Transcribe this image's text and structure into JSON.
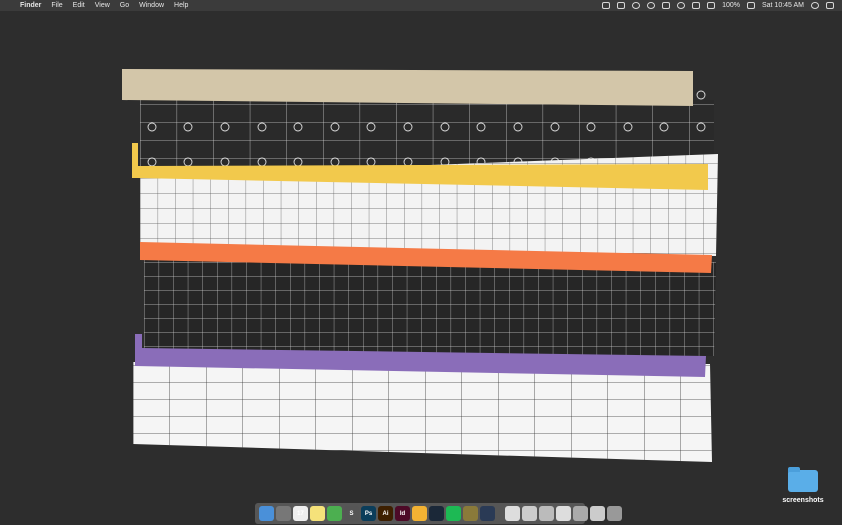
{
  "menubar": {
    "apple_glyph": "",
    "app_name": "Finder",
    "menus": [
      "File",
      "Edit",
      "View",
      "Go",
      "Window",
      "Help"
    ],
    "battery": "100%",
    "clock": "Sat 10:45 AM"
  },
  "desktop": {
    "folder_label": "screenshots"
  },
  "colors": {
    "tan": "#d3c6a9",
    "yellow": "#f2c94c",
    "orange": "#f57a46",
    "purple": "#8a6db9"
  },
  "dock": {
    "items": [
      {
        "icon": "finder-icon",
        "label": "",
        "color": "#4a90d9"
      },
      {
        "icon": "launchpad-icon",
        "label": "",
        "color": "#777"
      },
      {
        "icon": "calendar-icon",
        "label": "17",
        "color": "#eee"
      },
      {
        "icon": "notes-icon",
        "label": "",
        "color": "#f5e27a"
      },
      {
        "icon": "chrome-icon",
        "label": "",
        "color": "#4caf50"
      },
      {
        "icon": "scrivener-icon",
        "label": "S",
        "color": "#555"
      },
      {
        "icon": "photoshop-icon",
        "label": "Ps",
        "color": "#0b3d5a"
      },
      {
        "icon": "illustrator-icon",
        "label": "Ai",
        "color": "#3d1f00"
      },
      {
        "icon": "indesign-icon",
        "label": "Id",
        "color": "#4d0a27"
      },
      {
        "icon": "sketch-icon",
        "label": "",
        "color": "#f2b233"
      },
      {
        "icon": "steam-icon",
        "label": "",
        "color": "#1b2838"
      },
      {
        "icon": "spotify-icon",
        "label": "",
        "color": "#1db954"
      },
      {
        "icon": "pencil-icon",
        "label": "",
        "color": "#8a7a3a"
      },
      {
        "icon": "app-icon",
        "label": "",
        "color": "#2a3a55"
      },
      {
        "icon": "document-icon",
        "label": "",
        "color": "#ddd"
      },
      {
        "icon": "document-icon",
        "label": "",
        "color": "#ccc"
      },
      {
        "icon": "document-icon",
        "label": "",
        "color": "#bbb"
      },
      {
        "icon": "document-icon",
        "label": "",
        "color": "#ddd"
      },
      {
        "icon": "document-icon",
        "label": "",
        "color": "#aaa"
      },
      {
        "icon": "document-icon",
        "label": "",
        "color": "#ccc"
      },
      {
        "icon": "trash-icon",
        "label": "",
        "color": "#999"
      }
    ]
  }
}
